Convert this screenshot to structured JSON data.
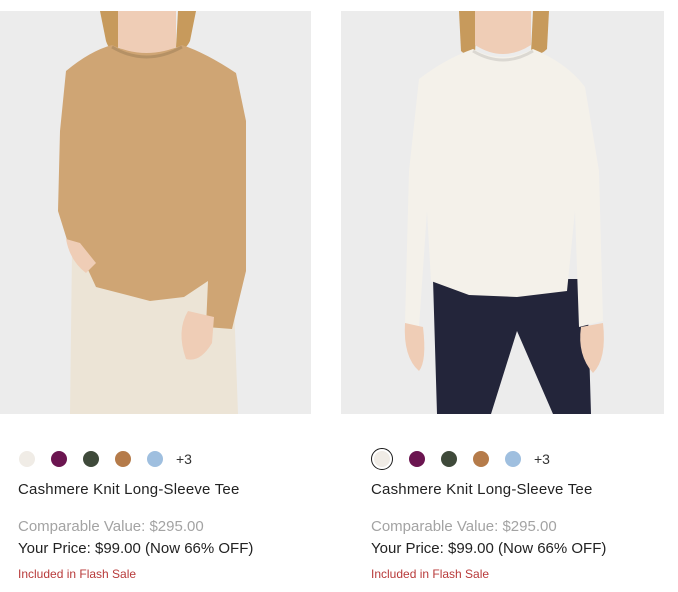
{
  "products": [
    {
      "name": "Cashmere Knit Long-Sleeve Tee",
      "swatches": [
        {
          "color": "#f0ece6",
          "selected": false
        },
        {
          "color": "#6b1550",
          "selected": false
        },
        {
          "color": "#3f4a3a",
          "selected": false
        },
        {
          "color": "#b57b4a",
          "selected": false
        },
        {
          "color": "#9fbfdf",
          "selected": false
        }
      ],
      "more_colors": "+3",
      "comparable_value": "Comparable Value: $295.00",
      "your_price": "Your Price: $99.00 (Now 66% OFF)",
      "flash_sale": "Included in Flash Sale",
      "sweater_color": "#cfa574",
      "pants_color": "#ece4d6"
    },
    {
      "name": "Cashmere Knit Long-Sleeve Tee",
      "swatches": [
        {
          "color": "#f0ece6",
          "selected": true
        },
        {
          "color": "#6b1550",
          "selected": false
        },
        {
          "color": "#3f4a3a",
          "selected": false
        },
        {
          "color": "#b57b4a",
          "selected": false
        },
        {
          "color": "#9fbfdf",
          "selected": false
        }
      ],
      "more_colors": "+3",
      "comparable_value": "Comparable Value: $295.00",
      "your_price": "Your Price: $99.00 (Now 66% OFF)",
      "flash_sale": "Included in Flash Sale",
      "sweater_color": "#f4f1ea",
      "pants_color": "#23253a"
    }
  ]
}
